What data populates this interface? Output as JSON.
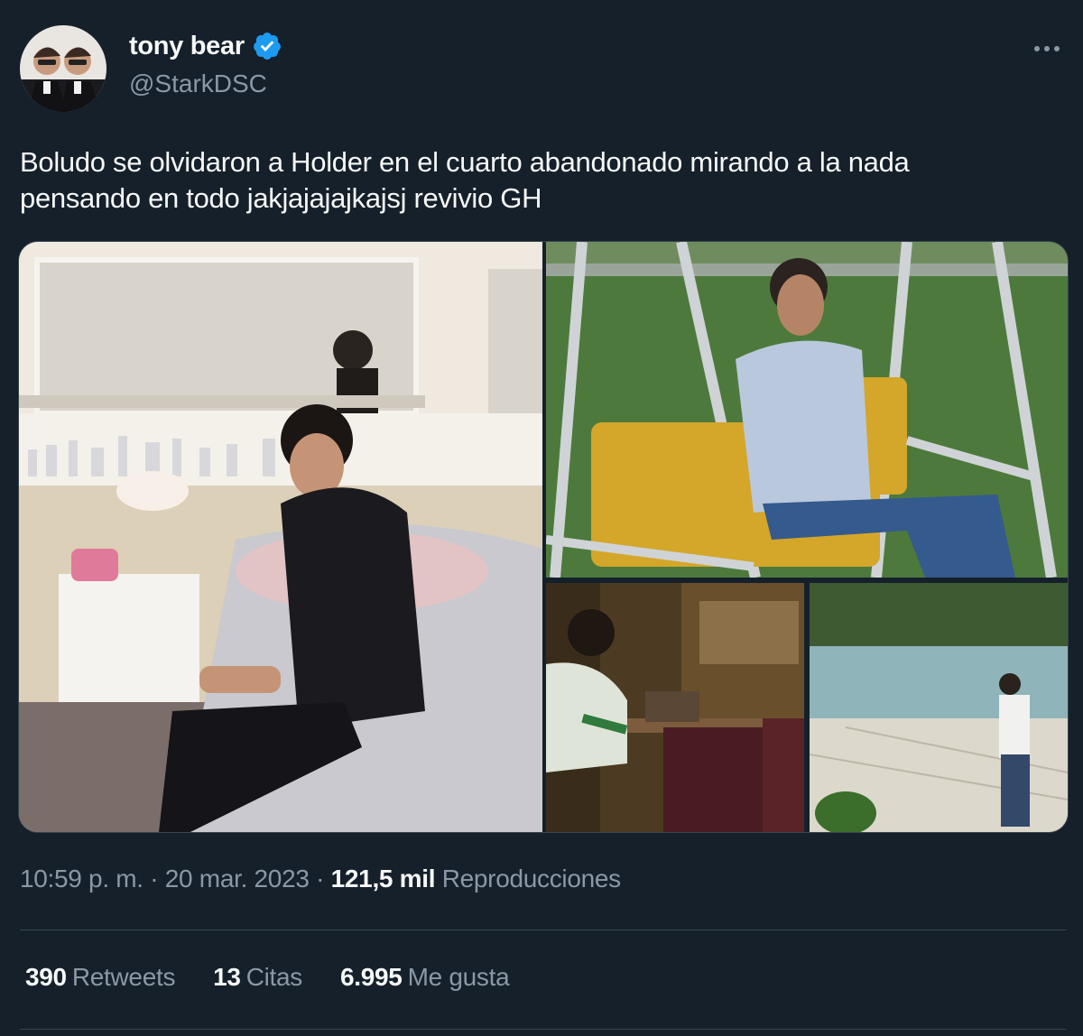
{
  "author": {
    "display_name": "tony bear",
    "handle": "@StarkDSC",
    "verified": true
  },
  "tweet": {
    "text_line1": "Boludo se olvidaron a Holder en el cuarto abandonado mirando a la nada",
    "text_line2": "pensando en todo jakjajajajkajsj revivio GH"
  },
  "media": {
    "images": [
      {
        "alt": "man sitting on bed"
      },
      {
        "alt": "man sitting on swing"
      },
      {
        "alt": "man sitting at table"
      },
      {
        "alt": "man standing by empty pool"
      }
    ]
  },
  "meta": {
    "time": "10:59 p. m.",
    "separator1": " · ",
    "date": "20 mar. 2023",
    "separator2": " · ",
    "views_count": "121,5 mil",
    "views_label": "Reproducciones"
  },
  "stats": {
    "retweets_count": "390",
    "retweets_label": "Retweets",
    "quotes_count": "13",
    "quotes_label": "Citas",
    "likes_count": "6.995",
    "likes_label": "Me gusta"
  },
  "colors": {
    "background": "#15202b",
    "text": "#f7f9f9",
    "secondary": "#8b98a5",
    "verified": "#1d9bf0",
    "border": "#38444d"
  },
  "icons": [
    "verified-badge-icon",
    "more-options-icon"
  ]
}
